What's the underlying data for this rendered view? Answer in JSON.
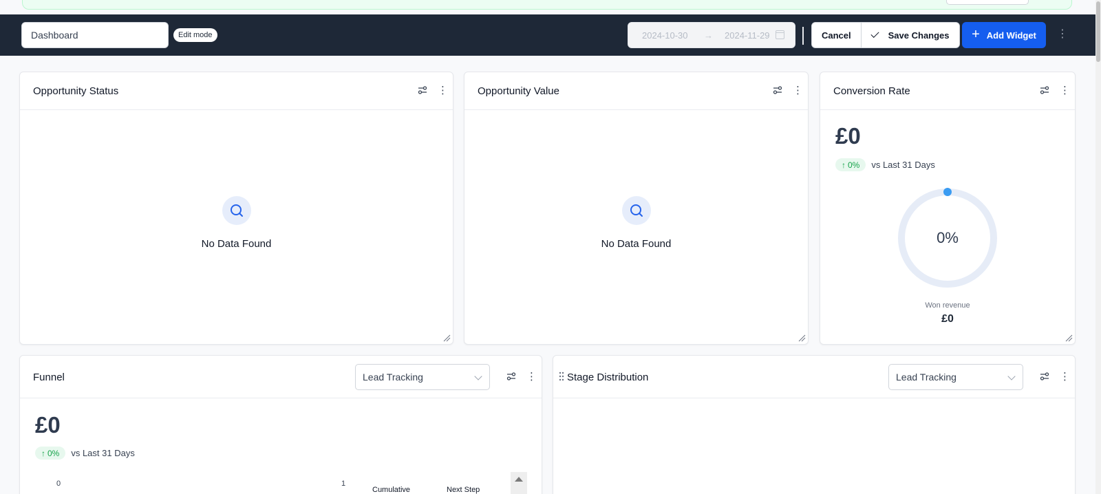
{
  "toolbar": {
    "dashboard_name": "Dashboard",
    "edit_mode_label": "Edit mode",
    "date_start": "2024-10-30",
    "date_end": "2024-11-29",
    "cancel_label": "Cancel",
    "save_label": "Save Changes",
    "add_widget_label": "Add Widget"
  },
  "widgets": {
    "opportunity_status": {
      "title": "Opportunity Status",
      "empty_label": "No Data Found"
    },
    "opportunity_value": {
      "title": "Opportunity Value",
      "empty_label": "No Data Found"
    },
    "conversion_rate": {
      "title": "Conversion Rate",
      "value": "£0",
      "trend_percent": "0%",
      "trend_label": "vs Last 31 Days",
      "gauge_value_text": "0%",
      "gauge_value": 0,
      "won_revenue_label": "Won revenue",
      "won_revenue_value": "£0"
    },
    "funnel": {
      "title": "Funnel",
      "pipeline_select": "Lead Tracking",
      "value": "£0",
      "trend_percent": "0%",
      "trend_label": "vs Last 31 Days",
      "axis_min": "0",
      "axis_max": "1",
      "col_cumulative": "Cumulative",
      "col_next_step": "Next Step"
    },
    "stage_distribution": {
      "title": "Stage Distribution",
      "pipeline_select": "Lead Tracking"
    }
  },
  "colors": {
    "toolbar_bg": "#1e2837",
    "primary": "#155eef",
    "success": "#16a34a",
    "gauge_track": "#e6ecf7",
    "gauge_dot": "#3b9cf2"
  },
  "icons": [
    "calendar-icon",
    "check-icon",
    "plus-icon",
    "kebab-icon",
    "filter-icon",
    "search-icon",
    "resize-icon",
    "arrow-up-icon",
    "chevron-down-icon",
    "drag-handle-icon"
  ]
}
